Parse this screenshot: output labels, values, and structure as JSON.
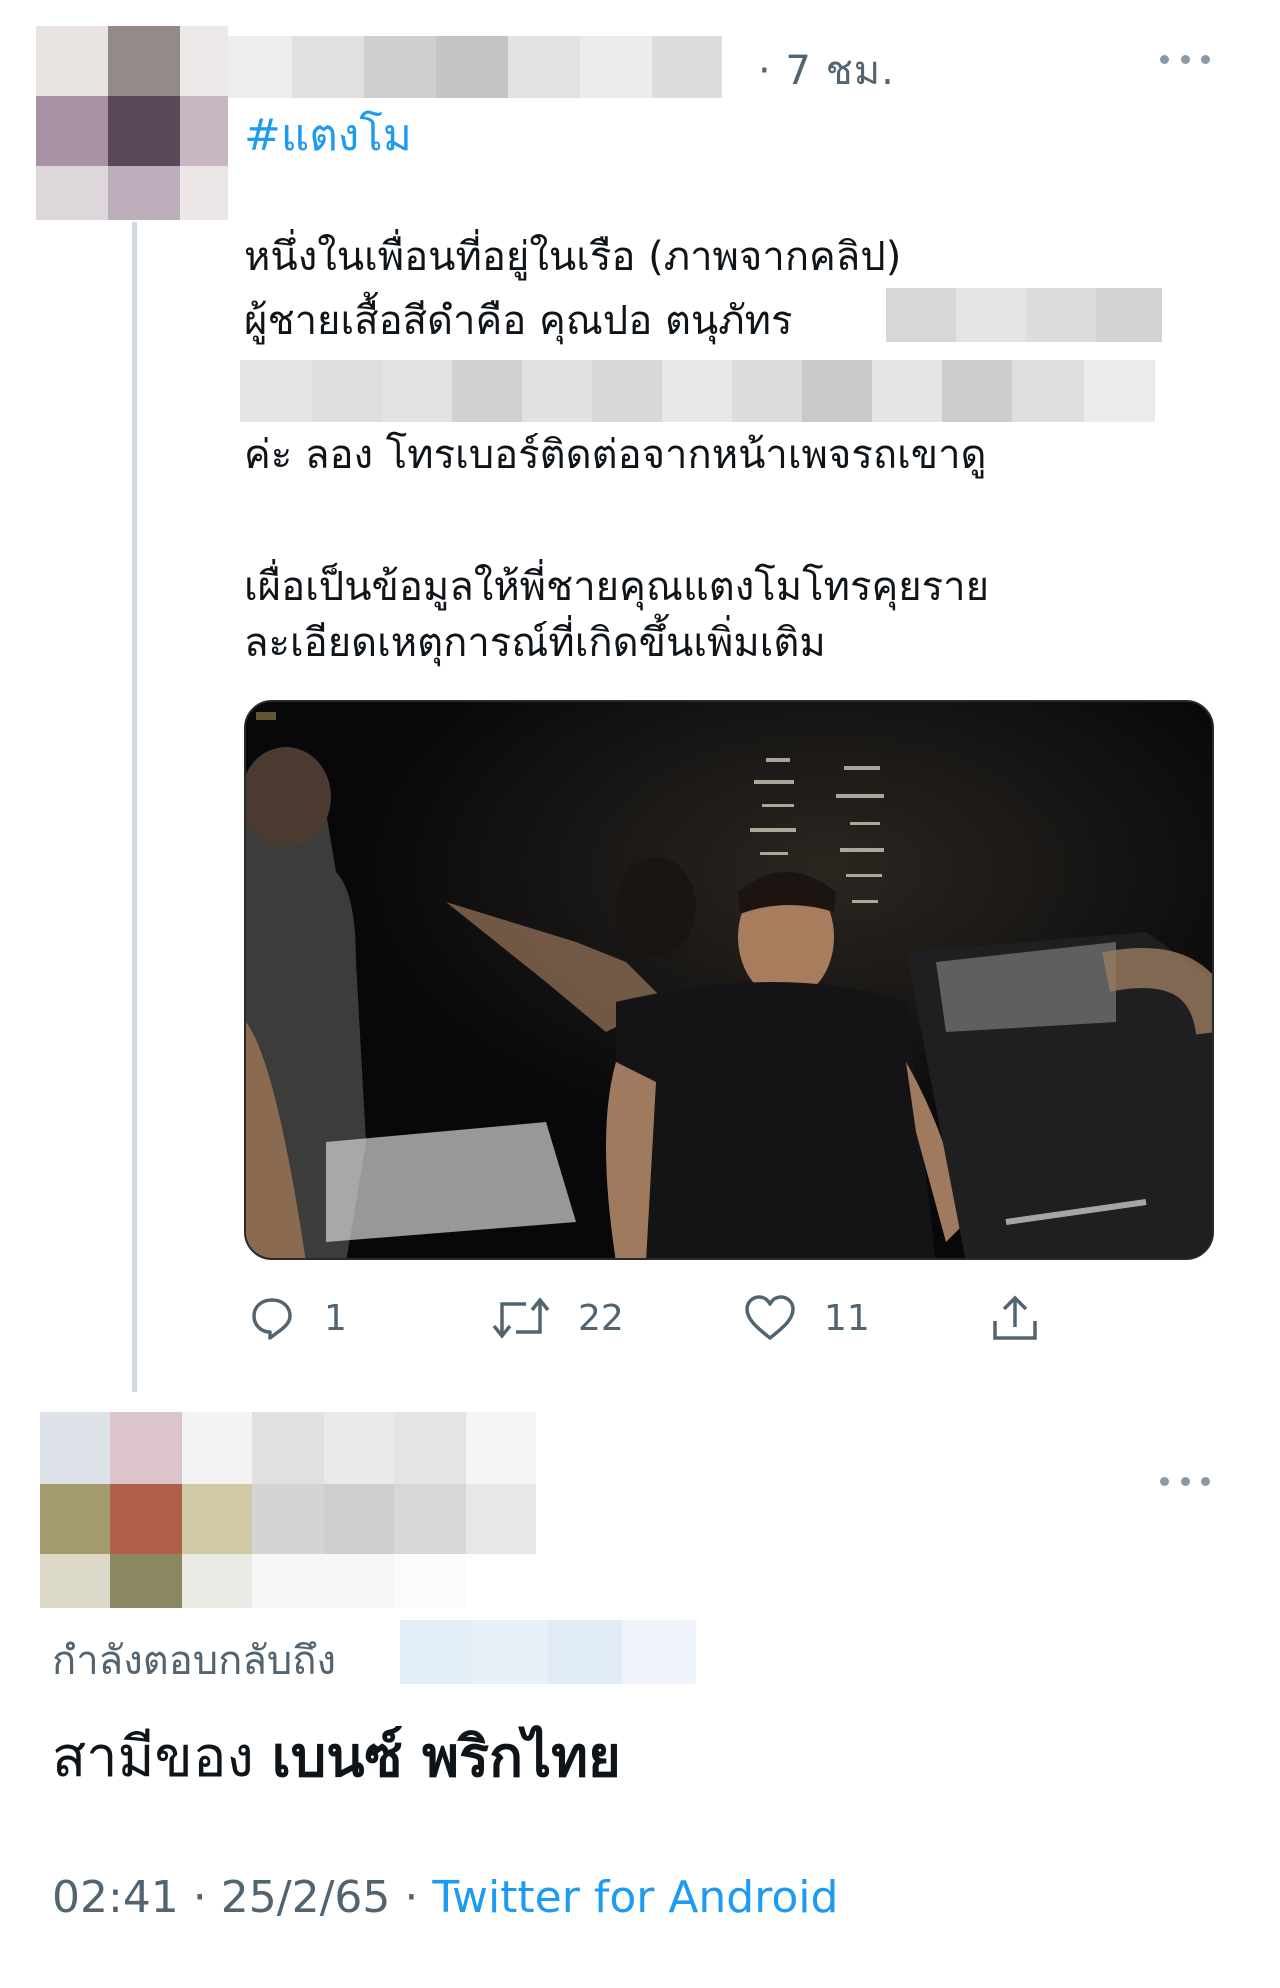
{
  "tweet": {
    "time": "· 7 ชม.",
    "hashtag": "#แตงโม",
    "lines": {
      "line1": "หนึ่งในเพื่อนที่อยู่ในเรือ (ภาพจากคลิป)",
      "line2": "ผู้ชายเสื้อสีดำคือ คุณปอ ตนุภัทร",
      "line4": "ค่ะ ลอง โทรเบอร์ติดต่อจากหน้าเพจรถเขาดู",
      "line5": "เผื่อเป็นข้อมูลให้พี่ชายคุณแตงโมโทรคุยราย",
      "line6": "ละเอียดเหตุการณ์ที่เกิดขึ้นเพิ่มเติม"
    },
    "stats": {
      "replies": "1",
      "retweets": "22",
      "likes": "11"
    }
  },
  "reply": {
    "replying_to": "กำลังตอบกลับถึง",
    "text_plain": "สามีของ ",
    "text_bold": "เบนซ์ พริกไทย",
    "time": "02:41",
    "sep1": " · ",
    "date": "25/2/65",
    "sep2": " · ",
    "source": "Twitter for Android"
  },
  "colors": {
    "link": "#1d9bf0",
    "secondary": "#536471",
    "text": "#0f1419",
    "thread_line": "#cfd9de"
  },
  "icons": [
    "reply-icon",
    "retweet-icon",
    "like-icon",
    "share-icon",
    "more-icon"
  ]
}
